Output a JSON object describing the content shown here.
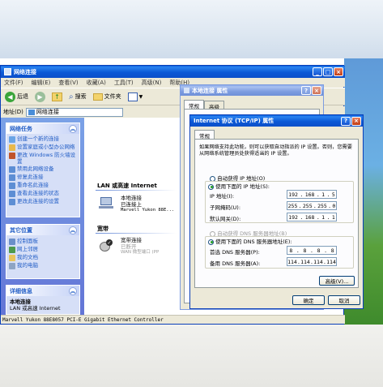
{
  "explorer": {
    "title": "网络连接",
    "menu": [
      "文件(F)",
      "编辑(E)",
      "查看(V)",
      "收藏(A)",
      "工具(T)",
      "高级(N)",
      "帮助(H)"
    ],
    "back_label": "后退",
    "search_label": "搜索",
    "folders_label": "文件夹",
    "address_label": "地址(D)",
    "address_value": "网络连接",
    "status_text": "Marvell Yukon 88E8057 PCI-E Gigabit Ethernet Controller"
  },
  "left_pane": {
    "network_tasks": {
      "title": "网络任务",
      "items": [
        "创建一个新的连接",
        "设置家庭或小型办公网络",
        "更改 Windows 防火墙设置",
        "禁用此网络设备",
        "修复此连接",
        "重命名此连接",
        "查看此连接的状态",
        "更改此连接的设置"
      ]
    },
    "other_places": {
      "title": "其它位置",
      "items": [
        "控制面板",
        "网上邻居",
        "我的文档",
        "我的电脑"
      ]
    },
    "details": {
      "title": "详细信息",
      "name": "本地连接",
      "type": "LAN 或高速 Internet"
    }
  },
  "content": {
    "group_lan": "LAN 或高速 Internet",
    "conn1": {
      "name": "本地连接",
      "status": "已连接上",
      "device": "Marvell Yukon 88E..."
    },
    "group_broadband": "宽带",
    "conn2": {
      "name": "宽带连接",
      "status": "已断开",
      "device": "WAN 微型端口 (PP"
    }
  },
  "props_dialog": {
    "title": "本地连接 属性",
    "tabs": [
      "常规",
      "高级"
    ]
  },
  "tcpip_dialog": {
    "title": "Internet 协议 (TCP/IP) 属性",
    "tab": "常规",
    "intro": "如果网络支持此功能，则可以获取自动指派的 IP 设置。否则，您需要从网络系统管理员处获得适当的 IP 设置。",
    "auto_ip": "自动获得 IP 地址(O)",
    "manual_ip": "使用下面的 IP 地址(S):",
    "ip_label": "IP 地址(I):",
    "ip_value": [
      "192",
      "168",
      "1",
      "5"
    ],
    "mask_label": "子网掩码(U):",
    "mask_value": [
      "255",
      "255",
      "255",
      "0"
    ],
    "gw_label": "默认网关(D):",
    "gw_value": [
      "192",
      "168",
      "1",
      "1"
    ],
    "auto_dns": "自动获得 DNS 服务器地址(B)",
    "manual_dns": "使用下面的 DNS 服务器地址(E):",
    "dns1_label": "首选 DNS 服务器(P):",
    "dns1_value": [
      "8",
      "8",
      "8",
      "8"
    ],
    "dns2_label": "备用 DNS 服务器(A):",
    "dns2_value": [
      "114",
      "114",
      "114",
      "114"
    ],
    "advanced_btn": "高级(V)...",
    "ok_btn": "确定",
    "cancel_btn": "取消"
  },
  "colors": {
    "titlebar": "#0b58d6",
    "task_link": "#215dc6",
    "desktop_green": "#3e8a2c"
  }
}
